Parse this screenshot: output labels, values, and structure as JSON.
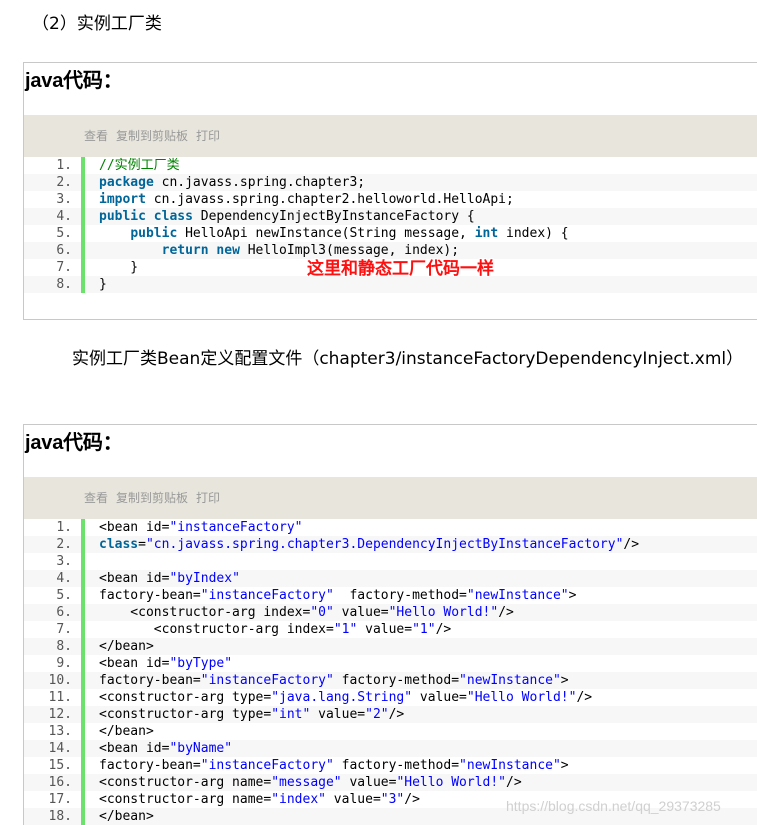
{
  "section_title": "（2）实例工厂类",
  "description": "实例工厂类Bean定义配置文件（chapter3/instanceFactoryDependencyInject.xml）",
  "blocks": [
    {
      "title": "java代码：",
      "toolbar": [
        "查看",
        "复制到剪贴板",
        "打印"
      ],
      "lines": [
        [
          {
            "t": "//实例工厂类",
            "c": "cm"
          }
        ],
        [
          {
            "t": "package",
            "c": "kw"
          },
          {
            "t": " cn.javass.spring.chapter3;"
          }
        ],
        [
          {
            "t": "import",
            "c": "kw"
          },
          {
            "t": " cn.javass.spring.chapter2.helloworld.HelloApi;"
          }
        ],
        [
          {
            "t": "public",
            "c": "kw"
          },
          {
            "t": " "
          },
          {
            "t": "class",
            "c": "kw"
          },
          {
            "t": " DependencyInjectByInstanceFactory {"
          }
        ],
        [
          {
            "t": "    "
          },
          {
            "t": "public",
            "c": "kw"
          },
          {
            "t": " HelloApi newInstance(String message, "
          },
          {
            "t": "int",
            "c": "kw"
          },
          {
            "t": " index) {"
          }
        ],
        [
          {
            "t": "        "
          },
          {
            "t": "return",
            "c": "kw"
          },
          {
            "t": " "
          },
          {
            "t": "new",
            "c": "kw"
          },
          {
            "t": " HelloImpl3(message, index);"
          }
        ],
        [
          {
            "t": "    }"
          }
        ],
        [
          {
            "t": "}"
          }
        ]
      ]
    },
    {
      "title": "java代码：",
      "toolbar": [
        "查看",
        "复制到剪贴板",
        "打印"
      ],
      "lines": [
        [
          {
            "t": "<bean id="
          },
          {
            "t": "\"instanceFactory\"",
            "c": "str"
          }
        ],
        [
          {
            "t": "class",
            "c": "kw"
          },
          {
            "t": "="
          },
          {
            "t": "\"cn.javass.spring.chapter3.DependencyInjectByInstanceFactory\"",
            "c": "str"
          },
          {
            "t": "/>"
          }
        ],
        [
          {
            "t": ""
          }
        ],
        [
          {
            "t": "<bean id="
          },
          {
            "t": "\"byIndex\"",
            "c": "str"
          }
        ],
        [
          {
            "t": "factory-bean="
          },
          {
            "t": "\"instanceFactory\"",
            "c": "str"
          },
          {
            "t": "  factory-method="
          },
          {
            "t": "\"newInstance\"",
            "c": "str"
          },
          {
            "t": ">"
          }
        ],
        [
          {
            "t": "    <constructor-arg index="
          },
          {
            "t": "\"0\"",
            "c": "str"
          },
          {
            "t": " value="
          },
          {
            "t": "\"Hello World!\"",
            "c": "str"
          },
          {
            "t": "/>"
          }
        ],
        [
          {
            "t": "       <constructor-arg index="
          },
          {
            "t": "\"1\"",
            "c": "str"
          },
          {
            "t": " value="
          },
          {
            "t": "\"1\"",
            "c": "str"
          },
          {
            "t": "/>"
          }
        ],
        [
          {
            "t": "</bean>"
          }
        ],
        [
          {
            "t": "<bean id="
          },
          {
            "t": "\"byType\"",
            "c": "str"
          }
        ],
        [
          {
            "t": "factory-bean="
          },
          {
            "t": "\"instanceFactory\"",
            "c": "str"
          },
          {
            "t": " factory-method="
          },
          {
            "t": "\"newInstance\"",
            "c": "str"
          },
          {
            "t": ">"
          }
        ],
        [
          {
            "t": "<constructor-arg type="
          },
          {
            "t": "\"java.lang.String\"",
            "c": "str"
          },
          {
            "t": " value="
          },
          {
            "t": "\"Hello World!\"",
            "c": "str"
          },
          {
            "t": "/>"
          }
        ],
        [
          {
            "t": "<constructor-arg type="
          },
          {
            "t": "\"int\"",
            "c": "str"
          },
          {
            "t": " value="
          },
          {
            "t": "\"2\"",
            "c": "str"
          },
          {
            "t": "/>"
          }
        ],
        [
          {
            "t": "</bean>"
          }
        ],
        [
          {
            "t": "<bean id="
          },
          {
            "t": "\"byName\"",
            "c": "str"
          }
        ],
        [
          {
            "t": "factory-bean="
          },
          {
            "t": "\"instanceFactory\"",
            "c": "str"
          },
          {
            "t": " factory-method="
          },
          {
            "t": "\"newInstance\"",
            "c": "str"
          },
          {
            "t": ">"
          }
        ],
        [
          {
            "t": "<constructor-arg name="
          },
          {
            "t": "\"message\"",
            "c": "str"
          },
          {
            "t": " value="
          },
          {
            "t": "\"Hello World!\"",
            "c": "str"
          },
          {
            "t": "/>"
          }
        ],
        [
          {
            "t": "<constructor-arg name="
          },
          {
            "t": "\"index\"",
            "c": "str"
          },
          {
            "t": " value="
          },
          {
            "t": "\"3\"",
            "c": "str"
          },
          {
            "t": "/>"
          }
        ],
        [
          {
            "t": "</bean>"
          }
        ]
      ]
    }
  ],
  "annotation": "这里和静态工厂代码一样",
  "watermark": "https://blog.csdn.net/qq_29373285",
  "colors": {
    "keyword": "#006699",
    "comment": "#008200",
    "string": "#0000ff",
    "gutter_bar": "#6ce26c",
    "annotation": "#ff1010"
  }
}
